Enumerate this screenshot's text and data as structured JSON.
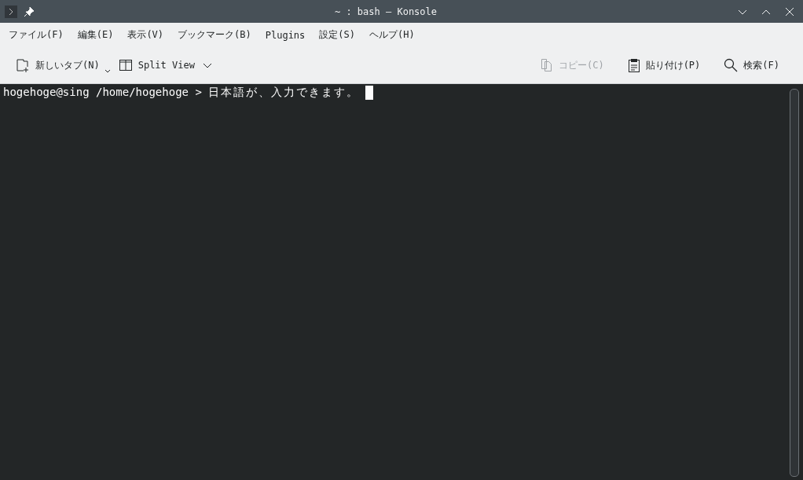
{
  "window": {
    "title": "~ : bash — Konsole"
  },
  "menu": [
    "ファイル(F)",
    "編集(E)",
    "表示(V)",
    "ブックマーク(B)",
    "Plugins",
    "設定(S)",
    "ヘルプ(H)"
  ],
  "toolbar_left": [
    {
      "kind": "new-tab",
      "label": "新しいタブ(N)",
      "disabled": false
    },
    {
      "kind": "split",
      "label": "Split View",
      "disabled": false
    }
  ],
  "toolbar_right": [
    {
      "kind": "copy",
      "label": "コピー(C)",
      "disabled": true
    },
    {
      "kind": "paste",
      "label": "貼り付け(P)",
      "disabled": false
    },
    {
      "kind": "search",
      "label": "検索(F)",
      "disabled": false
    }
  ],
  "terminal": {
    "prompt": "hogehoge@sing /home/hogehoge >",
    "input": "日本語が、入力できます。"
  }
}
